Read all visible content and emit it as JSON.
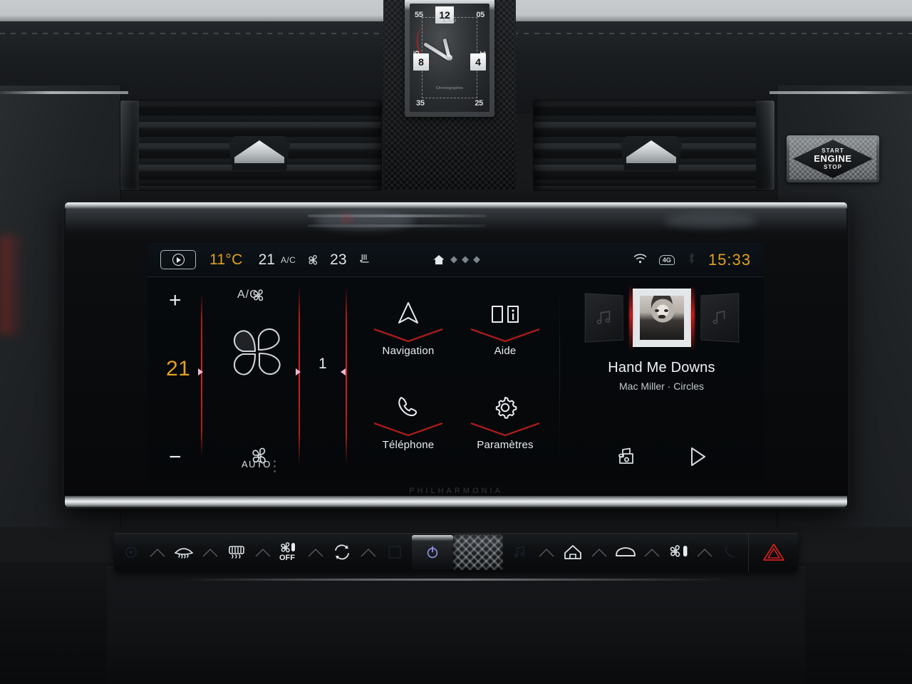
{
  "clock_module": {
    "brand": "B.R.M",
    "subtitle": "Chronographes",
    "numerals": [
      "12",
      "4",
      "8"
    ],
    "minute_marks": [
      "55",
      "05",
      "15",
      "25",
      "35",
      "45"
    ],
    "engine_button": {
      "line1": "START",
      "line2": "ENGINE",
      "line3": "STOP"
    }
  },
  "screen": {
    "bezel_brand": "PHILHARMONIA",
    "statusbar": {
      "media_badge_icon": "play-circle-icon",
      "exterior_temp": "11°C",
      "driver_temp": "21",
      "ac_label": "A/C",
      "fan_icon": "fan-icon",
      "passenger_temp": "23",
      "seat_heater_icon": "heated-seat-icon",
      "home_icon": "home-icon",
      "page_dots": 3,
      "wifi_icon": "wifi-icon",
      "network_badge": "4G",
      "bluetooth_icon": "bluetooth-icon",
      "time": "15:33"
    },
    "climate": {
      "ac_label": "A/C",
      "plus_label": "+",
      "minus_label": "−",
      "temperature": "21",
      "auto_label": "AUTO",
      "fan_level": "1",
      "fan_low_icon": "fan-small-icon",
      "fan_high_icon": "fan-large-icon",
      "blower_icon": "blower-fan-icon",
      "accent_color": "#d32222",
      "temp_color": "#e2a020"
    },
    "apps": [
      {
        "label": "Navigation",
        "icon": "navigation-arrow-icon"
      },
      {
        "label": "Aide",
        "icon": "help-book-icon"
      },
      {
        "label": "Téléphone",
        "icon": "phone-handset-icon"
      },
      {
        "label": "Paramètres",
        "icon": "gear-icon"
      }
    ],
    "media": {
      "track_title": "Hand Me Downs",
      "track_subtitle": "Mac Miller · Circles",
      "prev_cover_icon": "music-note-icon",
      "next_cover_icon": "music-note-icon",
      "source_icon": "media-source-icon",
      "play_icon": "play-icon"
    }
  },
  "button_bar": {
    "left_buttons": [
      {
        "name": "windshield-defrost-button",
        "icon": "windshield-defrost-icon"
      },
      {
        "name": "rear-defrost-button",
        "icon": "rear-defrost-icon"
      },
      {
        "name": "climate-off-button",
        "icon": "climate-off-icon",
        "label": "OFF"
      },
      {
        "name": "air-recirculation-button",
        "icon": "recirculation-icon"
      }
    ],
    "right_buttons": [
      {
        "name": "home-button",
        "icon": "home-icon"
      },
      {
        "name": "vehicle-button",
        "icon": "car-icon"
      },
      {
        "name": "climate-button",
        "icon": "climate-fan-icon"
      }
    ],
    "hazard_button": {
      "name": "hazard-lights-button",
      "icon": "hazard-triangle-icon"
    },
    "power_knob": {
      "name": "power-button",
      "icon": "power-icon"
    },
    "volume_knob": {
      "name": "volume-knob"
    }
  }
}
